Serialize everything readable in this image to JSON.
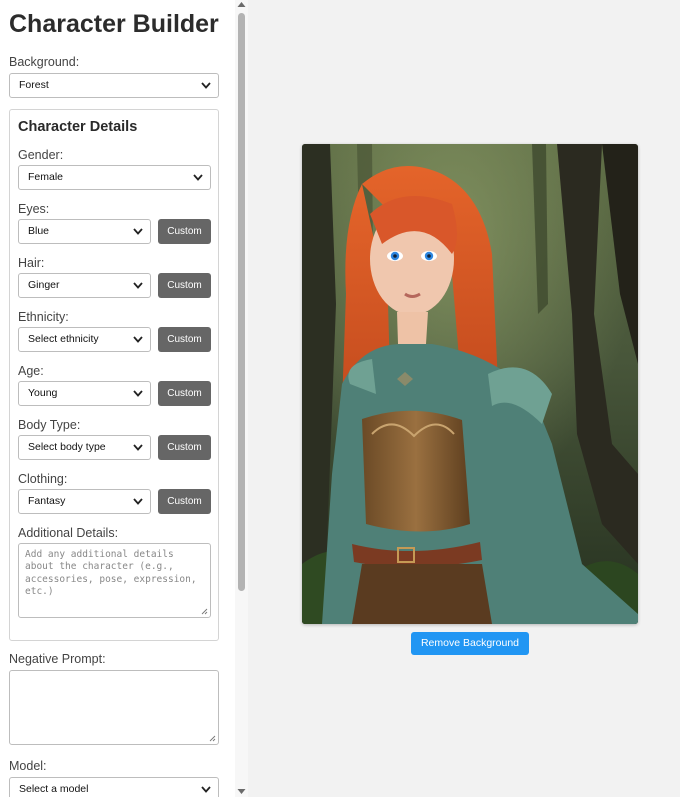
{
  "app": {
    "title": "Character Builder"
  },
  "background": {
    "label": "Background:",
    "value": "Forest"
  },
  "details": {
    "title": "Character Details",
    "gender": {
      "label": "Gender:",
      "value": "Female"
    },
    "eyes": {
      "label": "Eyes:",
      "value": "Blue",
      "custom_label": "Custom"
    },
    "hair": {
      "label": "Hair:",
      "value": "Ginger",
      "custom_label": "Custom"
    },
    "ethnicity": {
      "label": "Ethnicity:",
      "value": "Select ethnicity",
      "custom_label": "Custom"
    },
    "age": {
      "label": "Age:",
      "value": "Young",
      "custom_label": "Custom"
    },
    "body_type": {
      "label": "Body Type:",
      "value": "Select body type",
      "custom_label": "Custom"
    },
    "clothing": {
      "label": "Clothing:",
      "value": "Fantasy",
      "custom_label": "Custom"
    },
    "additional": {
      "label": "Additional Details:",
      "placeholder": "Add any additional details about the character (e.g., accessories, pose, expression, etc.)"
    }
  },
  "negative_prompt": {
    "label": "Negative Prompt:",
    "value": ""
  },
  "model": {
    "label": "Model:",
    "value": "Select a model"
  },
  "preview": {
    "remove_bg_label": "Remove Background"
  },
  "colors": {
    "accent": "#2196f3",
    "custom_button": "#666666",
    "hair": "#d4531f",
    "armor": "#4f8077",
    "forest": "#3c4a30"
  },
  "icons": {
    "dropdown": "chevron-down-icon",
    "scroll_up": "scroll-up-arrow-icon",
    "scroll_down": "scroll-down-arrow-icon"
  }
}
